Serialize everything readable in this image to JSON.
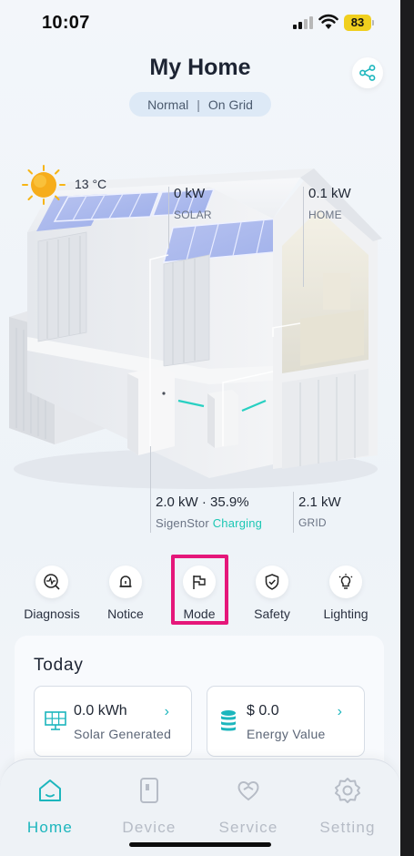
{
  "status_bar": {
    "time": "10:07",
    "battery": "83"
  },
  "header": {
    "title": "My Home",
    "status_mode": "Normal",
    "status_separator": "|",
    "status_grid": "On Grid"
  },
  "weather": {
    "temperature": "13 °C",
    "icon": "sun-icon"
  },
  "flows": {
    "solar": {
      "value": "0 kW",
      "label": "SOLAR"
    },
    "home": {
      "value": "0.1 kW",
      "label": "HOME"
    },
    "storage": {
      "value": "2.0 kW · 35.9%",
      "label": "SigenStor",
      "state": "Charging"
    },
    "grid": {
      "value": "2.1 kW",
      "label": "GRID"
    }
  },
  "shortcuts": [
    {
      "label": "Diagnosis",
      "icon": "diagnosis-icon"
    },
    {
      "label": "Notice",
      "icon": "bell-icon"
    },
    {
      "label": "Mode",
      "icon": "flag-icon"
    },
    {
      "label": "Safety",
      "icon": "shield-check-icon"
    },
    {
      "label": "Lighting",
      "icon": "lightbulb-icon"
    }
  ],
  "today": {
    "title": "Today",
    "cards": [
      {
        "value": "0.0 kWh",
        "label": "Solar Generated",
        "icon": "solar-panel-icon",
        "chevron": "›"
      },
      {
        "value": "$ 0.0",
        "label": "Energy Value",
        "icon": "coins-icon",
        "chevron": "›"
      }
    ]
  },
  "tabs": [
    {
      "label": "Home",
      "icon": "home-icon",
      "active": true
    },
    {
      "label": "Device",
      "icon": "device-icon",
      "active": false
    },
    {
      "label": "Service",
      "icon": "service-heart-icon",
      "active": false
    },
    {
      "label": "Setting",
      "icon": "gear-icon",
      "active": false
    }
  ],
  "colors": {
    "accent": "#1cb6bd",
    "charging": "#1cc7b4",
    "highlight": "#e5177a",
    "battery": "#f0cf1e"
  }
}
